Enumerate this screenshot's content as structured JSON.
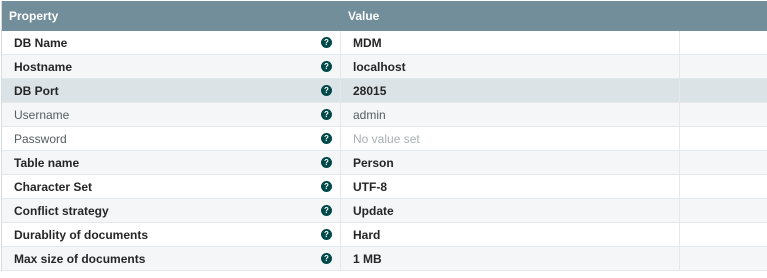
{
  "header": {
    "property": "Property",
    "value": "Value"
  },
  "rows": [
    {
      "name": "DB Name",
      "value": "MDM"
    },
    {
      "name": "Hostname",
      "value": "localhost"
    },
    {
      "name": "DB Port",
      "value": "28015"
    },
    {
      "name": "Username",
      "value": "admin"
    },
    {
      "name": "Password",
      "value": "No value set"
    },
    {
      "name": "Table name",
      "value": "Person"
    },
    {
      "name": "Character Set",
      "value": "UTF-8"
    },
    {
      "name": "Conflict strategy",
      "value": "Update"
    },
    {
      "name": "Durablity of documents",
      "value": "Hard"
    },
    {
      "name": "Max size of documents",
      "value": "1 MB"
    }
  ],
  "icons": {
    "help": "help-icon"
  },
  "colors": {
    "header_bg": "#728e9b",
    "help_icon": "#004849",
    "selected_row": "#dbe3e6"
  }
}
